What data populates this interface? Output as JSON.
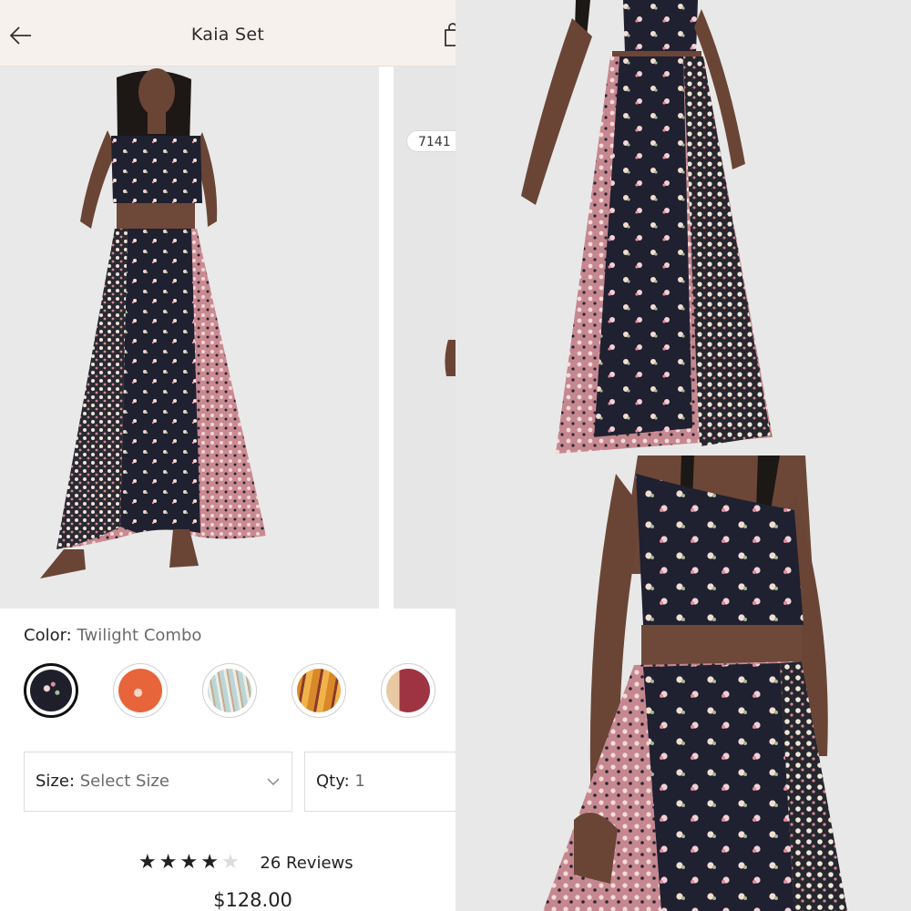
{
  "header": {
    "title": "Kaia Set",
    "back_icon": "arrow-left-icon",
    "bag_icon": "shopping-bag-icon"
  },
  "gallery": {
    "counter": "7141"
  },
  "color": {
    "label": "Color:",
    "value": "Twilight Combo",
    "swatches": [
      {
        "name": "twilight-combo",
        "color": "#1e1f2b"
      },
      {
        "name": "orange",
        "color": "#e8643b"
      },
      {
        "name": "light-blue",
        "color": "#bcd6d6"
      },
      {
        "name": "amber",
        "color": "#d9892a"
      },
      {
        "name": "berry",
        "color": "#9e3442"
      }
    ]
  },
  "size": {
    "label": "Size:",
    "value": "Select Size"
  },
  "qty": {
    "label": "Qty:",
    "value": "1"
  },
  "rating": {
    "stars": 4,
    "max": 5,
    "reviews": "26 Reviews"
  },
  "price": "$128.00"
}
